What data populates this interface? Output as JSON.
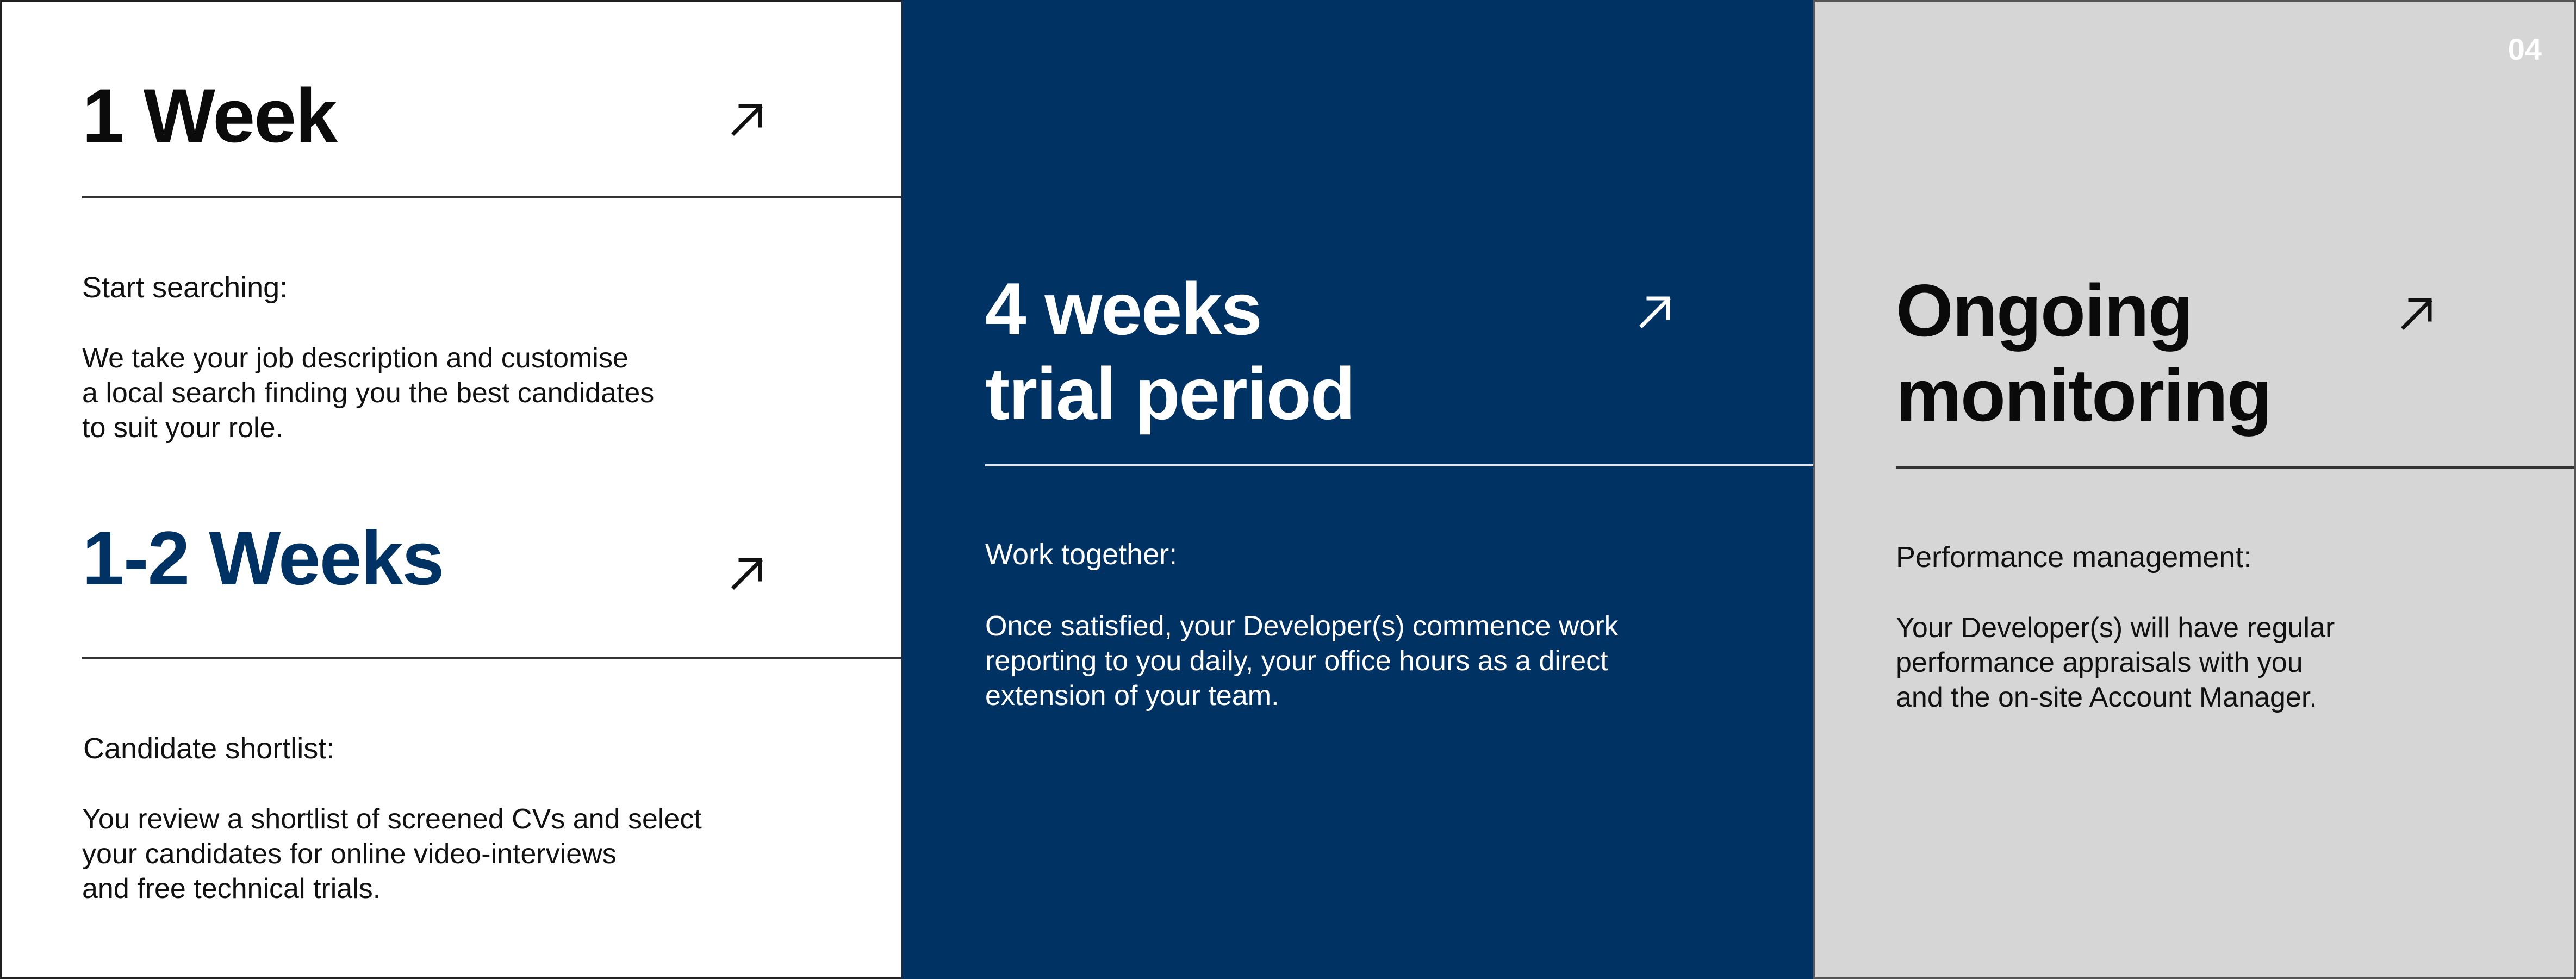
{
  "page_number": "04",
  "colors": {
    "navy": "#013264",
    "light_gray": "#d6d6d6",
    "white": "#ffffff"
  },
  "stages": [
    {
      "heading": "1 Week",
      "icon": "arrow-up-right-icon",
      "label": "Start searching:",
      "body": "We take your job description and customise\na local search finding you the best candidates\nto suit your role."
    },
    {
      "heading": "1-2 Weeks",
      "icon": "arrow-up-right-icon",
      "label": "Candidate shortlist:",
      "body": "You review a shortlist of screened CVs and select\nyour candidates for online video-interviews\nand free technical trials."
    },
    {
      "heading": "4 weeks\ntrial period",
      "icon": "arrow-up-right-icon",
      "label": "Work together:",
      "body": "Once satisfied, your Developer(s) commence work\nreporting to you daily, your office hours as a direct\nextension of your team."
    },
    {
      "heading": "Ongoing\nmonitoring",
      "icon": "arrow-up-right-icon",
      "label": "Performance management:",
      "body": "Your Developer(s) will have regular\nperformance appraisals with you\nand the on-site Account Manager."
    }
  ]
}
